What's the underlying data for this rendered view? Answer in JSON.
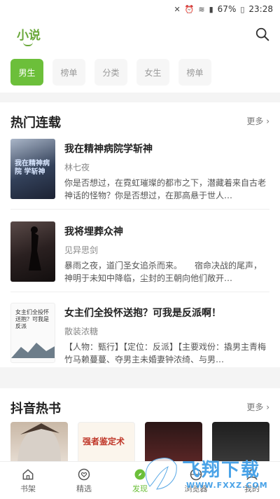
{
  "status": {
    "battery": "67%",
    "time": "23:28"
  },
  "header": {
    "logo": "小说"
  },
  "tabs": [
    {
      "label": "男生",
      "active": true
    },
    {
      "label": "榜单",
      "active": false
    },
    {
      "label": "分类",
      "active": false
    },
    {
      "label": "女生",
      "active": false
    },
    {
      "label": "榜单",
      "active": false
    }
  ],
  "hot_serial": {
    "title": "热门连载",
    "more": "更多",
    "books": [
      {
        "title": "我在精神病院学斩神",
        "author": "林七夜",
        "desc": "你是否想过，在霓虹璀璨的都市之下，潜藏着来自古老神话的怪物？你是否想过，在那高悬于世人…",
        "cover_text": "我在精神病院 学斩神"
      },
      {
        "title": "我将埋葬众神",
        "author": "见异思剑",
        "desc": "暴雨之夜，道门圣女追杀而来。　　宿命决战的尾声，神明于未知中降临，尘封的王朝向他们敞开…"
      },
      {
        "title": "女主们全投怀送抱？可我是反派啊！",
        "author": "散装浓糖",
        "desc": "【人物：甄行】【定位：反派】【主要戏份：撬男主青梅竹马赖蔓蔓、夺男主未婚妻钟浓绮、与男…",
        "cover_text": "女主们全投怀送抱？可我是反派"
      }
    ]
  },
  "douyin": {
    "title": "抖音热书",
    "more": "更多",
    "covers": [
      {},
      {
        "text": "强者鉴定术"
      },
      {},
      {}
    ]
  },
  "bottom_nav": [
    {
      "label": "书架",
      "icon": "home-icon",
      "active": false
    },
    {
      "label": "精选",
      "icon": "heart-icon",
      "active": false
    },
    {
      "label": "发现",
      "icon": "compass-icon",
      "active": true
    },
    {
      "label": "浏览器",
      "icon": "browser-icon",
      "active": false
    },
    {
      "label": "我的",
      "icon": "user-icon",
      "active": false
    }
  ],
  "watermark": {
    "text": "飞翔下载",
    "url": "WWW.FXXZ.COM"
  }
}
